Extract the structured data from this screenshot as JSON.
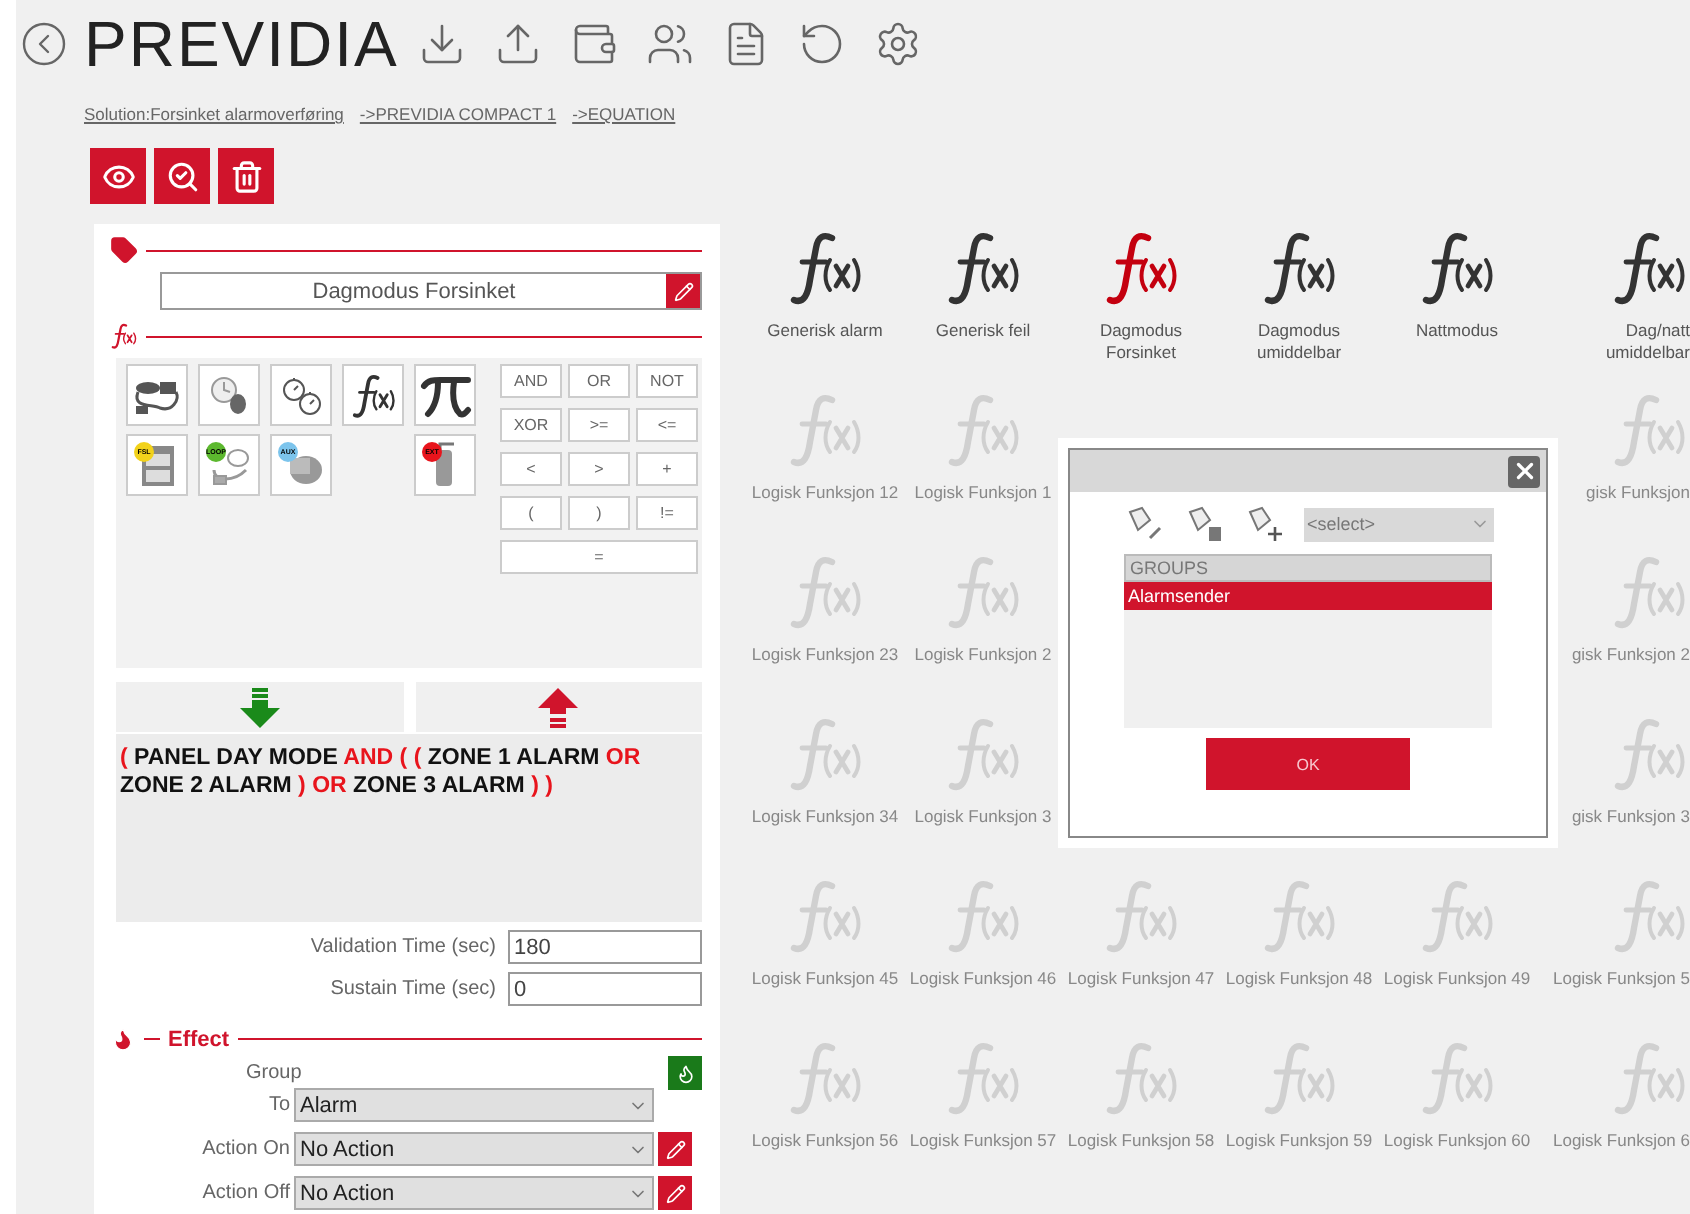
{
  "header": {
    "logo": "PREVIDIA"
  },
  "breadcrumb": [
    "Solution:Forsinket alarmoverføring",
    "->PREVIDIA COMPACT 1",
    "->EQUATION"
  ],
  "editor": {
    "name": "Dagmodus Forsinket",
    "tools": [
      [
        {
          "kind": "sensor"
        },
        {
          "kind": "clock-device"
        },
        {
          "kind": "timers"
        },
        {
          "kind": "function"
        },
        {
          "kind": "pi"
        }
      ],
      [
        {
          "kind": "panel",
          "badge": "FSL",
          "color": "#f2d21b"
        },
        {
          "kind": "loop",
          "badge": "LOOP",
          "color": "#5cb82e"
        },
        {
          "kind": "aux",
          "badge": "AUX",
          "color": "#7cc4ec"
        },
        {
          "kind": "empty"
        },
        {
          "kind": "extinguisher",
          "badge": "EXT",
          "color": "#e8141c"
        }
      ]
    ],
    "operators": [
      "AND",
      "OR",
      "NOT",
      "XOR",
      ">=",
      "<=",
      "<",
      ">",
      "+",
      "(",
      ")",
      "!=",
      "="
    ],
    "expression": [
      {
        "text": "(",
        "kind": "operator"
      },
      {
        "text": "PANEL  DAY MODE",
        "kind": "operand"
      },
      {
        "text": "AND",
        "kind": "operator"
      },
      {
        "text": "(",
        "kind": "operator"
      },
      {
        "text": "(",
        "kind": "operator"
      },
      {
        "text": "ZONE 1 ALARM",
        "kind": "operand"
      },
      {
        "text": "OR",
        "kind": "operator"
      },
      {
        "text": "ZONE 2 ALARM",
        "kind": "operand"
      },
      {
        "text": ")",
        "kind": "operator"
      },
      {
        "text": "OR",
        "kind": "operator"
      },
      {
        "text": "ZONE 3 ALARM",
        "kind": "operand"
      },
      {
        "text": ")",
        "kind": "operator"
      },
      {
        "text": ")",
        "kind": "operator"
      }
    ],
    "times": [
      {
        "label": "Validation Time (sec)",
        "value": "180"
      },
      {
        "label": "Sustain Time (sec)",
        "value": "0"
      }
    ],
    "effect": {
      "title": "Effect",
      "group_label": "Group",
      "fields": [
        {
          "label": "To",
          "value": "Alarm",
          "editable": false
        },
        {
          "label": "Action On",
          "value": "No Action",
          "editable": true
        },
        {
          "label": "Action Off",
          "value": "No Action",
          "editable": true
        }
      ]
    }
  },
  "functions": [
    {
      "kind": "function",
      "label": "Generisk alarm",
      "active": true,
      "selected": false
    },
    {
      "kind": "function",
      "label": "Generisk feil",
      "active": true,
      "selected": false
    },
    {
      "kind": "function",
      "label": "Dagmodus Forsinket",
      "active": true,
      "selected": true
    },
    {
      "kind": "function",
      "label": "Dagmodus umiddelbar",
      "active": true,
      "selected": false
    },
    {
      "kind": "function",
      "label": "Nattmodus",
      "active": true,
      "selected": false
    },
    {
      "kind": "function",
      "label": "Dag/natt umiddelbar",
      "active": true,
      "selected": false
    },
    {
      "kind": "function",
      "label": "Logisk Funksjon 12",
      "active": false,
      "selected": false
    },
    {
      "kind": "function",
      "label": "Logisk Funksjon 1",
      "active": false,
      "selected": false
    },
    {
      "kind": "covered"
    },
    {
      "kind": "covered"
    },
    {
      "kind": "covered"
    },
    {
      "kind": "function",
      "label": "gisk Funksjon",
      "active": false,
      "selected": false
    },
    {
      "kind": "function",
      "label": "Logisk Funksjon 23",
      "active": false,
      "selected": false
    },
    {
      "kind": "function",
      "label": "Logisk Funksjon 2",
      "active": false,
      "selected": false
    },
    {
      "kind": "covered"
    },
    {
      "kind": "covered"
    },
    {
      "kind": "covered"
    },
    {
      "kind": "function",
      "label": "gisk Funksjon 2",
      "active": false,
      "selected": false
    },
    {
      "kind": "function",
      "label": "Logisk Funksjon 34",
      "active": false,
      "selected": false
    },
    {
      "kind": "function",
      "label": "Logisk Funksjon 3",
      "active": false,
      "selected": false
    },
    {
      "kind": "covered"
    },
    {
      "kind": "covered"
    },
    {
      "kind": "covered"
    },
    {
      "kind": "function",
      "label": "gisk Funksjon 3",
      "active": false,
      "selected": false
    },
    {
      "kind": "function",
      "label": "Logisk Funksjon 45",
      "active": false,
      "selected": false
    },
    {
      "kind": "function",
      "label": "Logisk Funksjon 46",
      "active": false,
      "selected": false
    },
    {
      "kind": "function",
      "label": "Logisk Funksjon 47",
      "active": false,
      "selected": false
    },
    {
      "kind": "function",
      "label": "Logisk Funksjon 48",
      "active": false,
      "selected": false
    },
    {
      "kind": "function",
      "label": "Logisk Funksjon 49",
      "active": false,
      "selected": false
    },
    {
      "kind": "function",
      "label": "Logisk Funksjon 5",
      "active": false,
      "selected": false
    },
    {
      "kind": "function",
      "label": "Logisk Funksjon 56",
      "active": false,
      "selected": false
    },
    {
      "kind": "function",
      "label": "Logisk Funksjon 57",
      "active": false,
      "selected": false
    },
    {
      "kind": "function",
      "label": "Logisk Funksjon 58",
      "active": false,
      "selected": false
    },
    {
      "kind": "function",
      "label": "Logisk Funksjon 59",
      "active": false,
      "selected": false
    },
    {
      "kind": "function",
      "label": "Logisk Funksjon 60",
      "active": false,
      "selected": false
    },
    {
      "kind": "function",
      "label": "Logisk Funksjon 6",
      "active": false,
      "selected": false
    }
  ],
  "dialog": {
    "select_placeholder": "<select>",
    "list_header": "GROUPS",
    "items": [
      {
        "label": "Alarmsender",
        "selected": true
      }
    ],
    "ok": "OK"
  }
}
